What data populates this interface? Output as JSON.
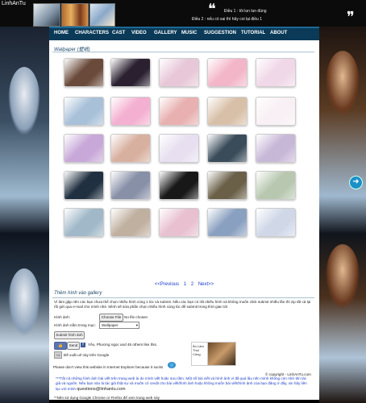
{
  "header": {
    "site_name": "LinhAnTu",
    "quote_line1": "Điều 1 : tôi lun lun đúng",
    "quote_line2": "Điều 2 : nếu có sai thì hãy coi lại điều 1"
  },
  "nav": [
    "HOME",
    "CHARACTERS",
    "CAST",
    "VIDEO",
    "GALLERY",
    "MUSIC",
    "SUGGESTION",
    "TUTORIAL",
    "ABOUT"
  ],
  "gallery": {
    "title": "Wallpaper (壁纸)",
    "thumb_colors": [
      "#6a4a3a",
      "#2a2030",
      "#e8c8d8",
      "#f3b6c8",
      "#f0d8e8",
      "#a8c0d8",
      "#f4b0d0",
      "#e8b0b0",
      "#d8c0a8",
      "#f8f0f4",
      "#c8a8d8",
      "#d8b0a0",
      "#e8e0f0",
      "#3a4c5a",
      "#c8b8d8",
      "#203040",
      "#8890a8",
      "#181818",
      "#6a6048",
      "#b8c8b0",
      "#a0b8c8",
      "#c0b0a0",
      "#e8c0d0",
      "#8aa0c0",
      "#d0d8e8"
    ]
  },
  "pager": {
    "prev": "<<Previous",
    "pages": [
      "1",
      "2"
    ],
    "next": "Next>>"
  },
  "add": {
    "title": "Thêm hình vào gallery",
    "instructions": "Vì làm gặp nên các bạn chưa thể chọn nhiều hình cùng 1 lúc và submit. Nếu các bạn có rất nhiều hình và không muốn click submit nhiều lần thì zip tất cả lại rồi gửi qua e-mail cho mình nhé. Mình sẽ sửa phần chọn nhiều hình cùng lúc để submit trong thời gian tới",
    "image_label": "Hình ảnh:",
    "choose_file": "Choose File",
    "no_file": "No file chosen",
    "category_label": "Hình ảnh nằm trong mục:",
    "category_value": "Wallpaper",
    "submit": "Submit hình ảnh",
    "like_count_text": "Yêu, Phương ngọc and 46 others like this.",
    "send_label": "Send",
    "google_text": "Đề xuất url này trên Google",
    "signature_text": "Ân Lâm Thúi Công"
  },
  "footer": {
    "note1": "***Tất cả những hình ảnh bài viết trên trang web ài do mình viết hoặc sưu tầm. Một số bài viết và hình ảnh vì đã quá lâu nên mình không còn nhớ tên tác giả và nguồn. Nếu bạn nào là tác giả thật sự và muốn có credit cho bài viết/hình ảnh hoặc không muốn bài viết/hình ảnh của bạn đăng ở đây, xin hãy liên lạc với mình",
    "email": "questions@linhantu.com",
    "note2": "**Nên sử dụng Google Chrome or Firefox để xem trang web này",
    "note3": "Please don't view this website in Internet Explorer because it sucks",
    "copyright": "© copyright - LinhAnTu.com"
  }
}
